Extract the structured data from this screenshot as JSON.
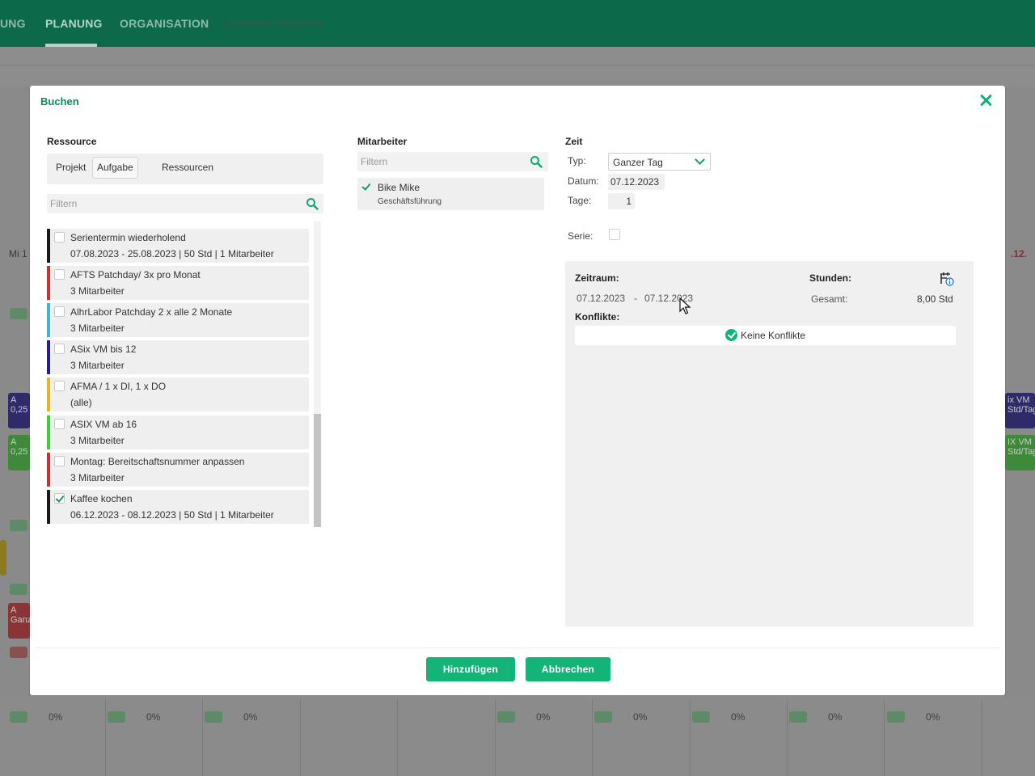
{
  "background": {
    "nav": [
      "UNG",
      "PLANUNG",
      "ORGANISATION",
      "ADMINISTRATION"
    ],
    "nav_active": "PLANUNG",
    "day_left": "Mi 1",
    "day_right": ".12.",
    "blocks_left": [
      "A",
      "0,25",
      "A",
      "0,25",
      "A",
      "Ganz"
    ],
    "blocks_right": [
      "ix VM",
      "Std/Tag",
      "IX VM",
      "Std/Tag"
    ],
    "percent_label": "0%"
  },
  "modal": {
    "title": "Buchen",
    "ressource": {
      "heading": "Ressource",
      "tabs": [
        "Projekt",
        "Aufgabe",
        "Ressourcen"
      ],
      "active_tab": "Aufgabe",
      "filter_placeholder": "Filtern",
      "items": [
        {
          "name": "Serientermin wiederholend",
          "meta": "07.08.2023 - 25.08.2023 | 50 Std | 1 Mitarbeiter",
          "color": "#1a1a1a",
          "checked": false
        },
        {
          "name": "AFTS Patchday/ 3x pro Monat",
          "meta": "3 Mitarbeiter",
          "color": "#d82b2b",
          "checked": false
        },
        {
          "name": "AlhrLabor Patchday 2 x alle 2 Monate",
          "meta": "3 Mitarbeiter",
          "color": "#3fb2e0",
          "checked": false
        },
        {
          "name": "ASix VM bis 12",
          "meta": "3 Mitarbeiter",
          "color": "#2a1a9a",
          "checked": false
        },
        {
          "name": "AFMA / 1 x DI, 1 x DO",
          "meta": "(alle)",
          "color": "#f0b21a",
          "checked": false
        },
        {
          "name": "ASIX VM ab 16",
          "meta": "3 Mitarbeiter",
          "color": "#2ed62e",
          "checked": false
        },
        {
          "name": "Montag: Bereitschaftsnummer anpassen",
          "meta": "3 Mitarbeiter",
          "color": "#d82b2b",
          "checked": false
        },
        {
          "name": "Kaffee kochen",
          "meta": "06.12.2023 - 08.12.2023 | 50 Std | 1 Mitarbeiter",
          "color": "#1a1a1a",
          "checked": true
        }
      ]
    },
    "mitarbeiter": {
      "heading": "Mitarbeiter",
      "filter_placeholder": "Filtern",
      "items": [
        {
          "name": "Bike Mike",
          "role": "Geschäftsführung",
          "checked": true
        }
      ]
    },
    "zeit": {
      "heading": "Zeit",
      "typ_label": "Typ:",
      "typ_value": "Ganzer Tag",
      "datum_label": "Datum:",
      "datum_value": "07.12.2023",
      "tage_label": "Tage:",
      "tage_value": "1",
      "serie_label": "Serie:",
      "serie_checked": false
    },
    "summary": {
      "zeitraum_label": "Zeitraum:",
      "from": "07.12.2023",
      "separator": "-",
      "to": "07.12.2023",
      "stunden_label": "Stunden:",
      "gesamt_label": "Gesamt:",
      "gesamt_value": "8,00 Std",
      "konflikte_label": "Konflikte:",
      "konflikte_value": "Keine Konflikte"
    },
    "buttons": {
      "add": "Hinzufügen",
      "cancel": "Abbrechen"
    },
    "colors": {
      "accent": "#14b377",
      "header_green": "#0c6a4b"
    }
  }
}
